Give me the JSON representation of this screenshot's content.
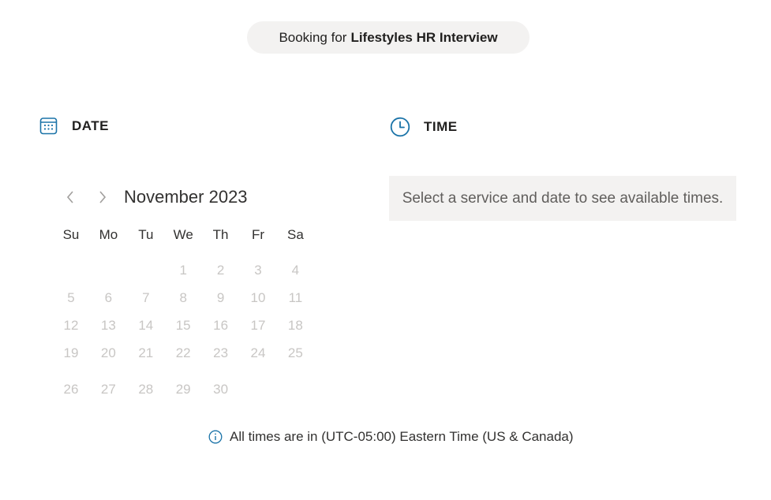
{
  "header": {
    "booking_prefix": "Booking for",
    "service_name": "Lifestyles HR Interview"
  },
  "date_section": {
    "title": "DATE",
    "icon": "calendar-icon",
    "prev_icon": "chevron-left-icon",
    "next_icon": "chevron-right-icon",
    "month_label": "November 2023",
    "weekdays": [
      "Su",
      "Mo",
      "Tu",
      "We",
      "Th",
      "Fr",
      "Sa"
    ],
    "first_weekday_index": 3,
    "days": [
      "1",
      "2",
      "3",
      "4",
      "5",
      "6",
      "7",
      "8",
      "9",
      "10",
      "11",
      "12",
      "13",
      "14",
      "15",
      "16",
      "17",
      "18",
      "19",
      "20",
      "21",
      "22",
      "23",
      "24",
      "25",
      "26",
      "27",
      "28",
      "29",
      "30"
    ]
  },
  "time_section": {
    "title": "TIME",
    "icon": "clock-icon",
    "message": "Select a service and date to see available times."
  },
  "timezone": {
    "icon": "info-icon",
    "text": "All times are in (UTC-05:00) Eastern Time (US & Canada)"
  },
  "colors": {
    "accent": "#0f6cbd",
    "disabled_day": "#c8c6c4",
    "panel_bg": "#f3f2f1"
  }
}
